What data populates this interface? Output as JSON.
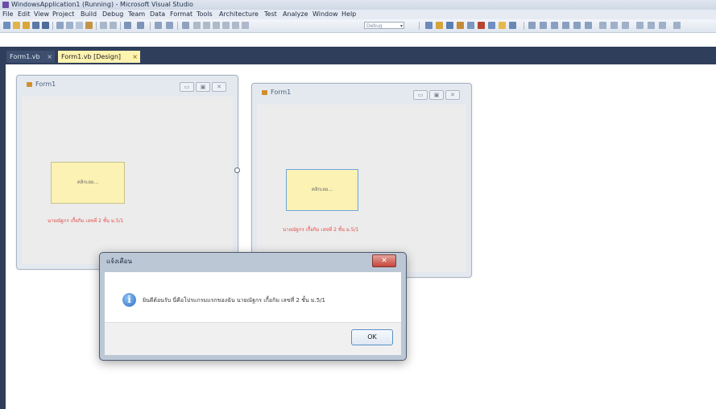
{
  "window": {
    "title": "WindowsApplication1 (Running) - Microsoft Visual Studio"
  },
  "menu": {
    "items": [
      "File",
      "Edit",
      "View",
      "Project",
      "Build",
      "Debug",
      "Team",
      "Data",
      "Format",
      "Tools",
      "Architecture",
      "Test",
      "Analyze",
      "Window",
      "Help"
    ]
  },
  "toolbar": {
    "config_value": "Debug"
  },
  "tabs": [
    {
      "label": "Form1.vb",
      "close": "×",
      "active": false
    },
    {
      "label": "Form1.vb [Design]",
      "close": "×",
      "active": true
    }
  ],
  "designer_form": {
    "title": "Form1",
    "button_label": "คลิกเลย...",
    "label_text": "นายณัฐกร เกื้อกิม เลขที่ 2 ชั้น ม.5/1",
    "controls": [
      "▭",
      "▣",
      "✕"
    ]
  },
  "running_form": {
    "title": "Form1",
    "button_label": "คลิกเลย...",
    "label_text": "นายณัฐกร เกื้อกิม เลขที่ 2 ชั้น ม.5/1",
    "controls": [
      "▭",
      "▣",
      "✕"
    ]
  },
  "message_box": {
    "title": "แจ้งเตือน",
    "close_glyph": "✕",
    "icon_glyph": "i",
    "message": "ยินดีต้อนรับ นี่คือโปรแกรมแรกของฉัน นายณัฐกร เกื้อกิม เลขที่ 2 ชั้น ม.5/1",
    "ok_label": "OK"
  },
  "colors": {
    "tab_active": "#fff3b0",
    "tabstrip": "#2f3f5b",
    "button_face": "#fbf2b3",
    "label_red": "#e24c4c",
    "msgbox_close": "#c6443a"
  }
}
